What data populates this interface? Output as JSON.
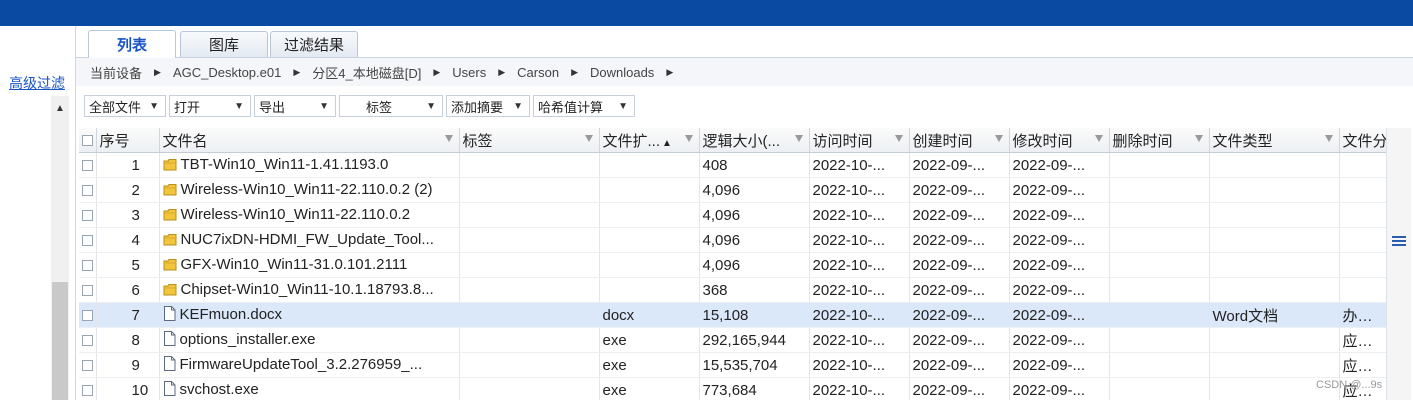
{
  "tabs": [
    "列表",
    "图库",
    "过滤结果"
  ],
  "left_panel": {
    "filter_link": "高级过滤"
  },
  "breadcrumb": [
    "当前设备",
    "AGC_Desktop.e01",
    "分区4_本地磁盘[D]",
    "Users",
    "Carson",
    "Downloads"
  ],
  "toolbar": [
    {
      "label": "全部文件"
    },
    {
      "label": "打开"
    },
    {
      "label": "导出"
    },
    {
      "label": "标签"
    },
    {
      "label": "添加摘要"
    },
    {
      "label": "哈希值计算"
    }
  ],
  "columns": [
    "序号",
    "文件名",
    "标签",
    "文件扩...",
    "逻辑大小(...",
    "访问时间",
    "创建时间",
    "修改时间",
    "删除时间",
    "文件类型",
    "文件分"
  ],
  "rows": [
    {
      "num": "1",
      "icon": "folder-icon",
      "name": "TBT-Win10_Win11-1.41.1193.0",
      "tag": "",
      "ext": "",
      "size": "408",
      "access": "2022-10-...",
      "create": "2022-09-...",
      "modify": "2022-09-...",
      "delete": "",
      "type": "",
      "cat": ""
    },
    {
      "num": "2",
      "icon": "folder-icon",
      "name": "Wireless-Win10_Win11-22.110.0.2 (2)",
      "tag": "",
      "ext": "",
      "size": "4,096",
      "access": "2022-10-...",
      "create": "2022-09-...",
      "modify": "2022-09-...",
      "delete": "",
      "type": "",
      "cat": ""
    },
    {
      "num": "3",
      "icon": "folder-icon",
      "name": "Wireless-Win10_Win11-22.110.0.2",
      "tag": "",
      "ext": "",
      "size": "4,096",
      "access": "2022-10-...",
      "create": "2022-09-...",
      "modify": "2022-09-...",
      "delete": "",
      "type": "",
      "cat": ""
    },
    {
      "num": "4",
      "icon": "folder-icon",
      "name": "NUC7ixDN-HDMI_FW_Update_Tool...",
      "tag": "",
      "ext": "",
      "size": "4,096",
      "access": "2022-10-...",
      "create": "2022-09-...",
      "modify": "2022-09-...",
      "delete": "",
      "type": "",
      "cat": ""
    },
    {
      "num": "5",
      "icon": "folder-icon",
      "name": "GFX-Win10_Win11-31.0.101.2111",
      "tag": "",
      "ext": "",
      "size": "4,096",
      "access": "2022-10-...",
      "create": "2022-09-...",
      "modify": "2022-09-...",
      "delete": "",
      "type": "",
      "cat": ""
    },
    {
      "num": "6",
      "icon": "folder-icon",
      "name": "Chipset-Win10_Win11-10.1.18793.8...",
      "tag": "",
      "ext": "",
      "size": "368",
      "access": "2022-10-...",
      "create": "2022-09-...",
      "modify": "2022-09-...",
      "delete": "",
      "type": "",
      "cat": ""
    },
    {
      "num": "7",
      "icon": "file-icon",
      "name": "KEFmuon.docx",
      "tag": "",
      "ext": "docx",
      "size": "15,108",
      "access": "2022-10-...",
      "create": "2022-09-...",
      "modify": "2022-09-...",
      "delete": "",
      "type": "Word文档",
      "cat": "办公文"
    },
    {
      "num": "8",
      "icon": "file-icon",
      "name": "options_installer.exe",
      "tag": "",
      "ext": "exe",
      "size": "292,165,944",
      "access": "2022-10-...",
      "create": "2022-09-...",
      "modify": "2022-09-...",
      "delete": "",
      "type": "",
      "cat": "应用程"
    },
    {
      "num": "9",
      "icon": "file-icon",
      "name": "FirmwareUpdateTool_3.2.276959_...",
      "tag": "",
      "ext": "exe",
      "size": "15,535,704",
      "access": "2022-10-...",
      "create": "2022-09-...",
      "modify": "2022-09-...",
      "delete": "",
      "type": "",
      "cat": "应用程"
    },
    {
      "num": "10",
      "icon": "file-icon",
      "name": "svchost.exe",
      "tag": "",
      "ext": "exe",
      "size": "773,684",
      "access": "2022-10-...",
      "create": "2022-09-...",
      "modify": "2022-09-...",
      "delete": "",
      "type": "",
      "cat": "应用程"
    }
  ],
  "selected_row": 6,
  "watermark": "CSDN @...9s",
  "colors": {
    "titlebar": "#0a4aa3",
    "selection": "#dbe8fa",
    "link": "#1a55c4",
    "folder": "#f2c53d"
  }
}
